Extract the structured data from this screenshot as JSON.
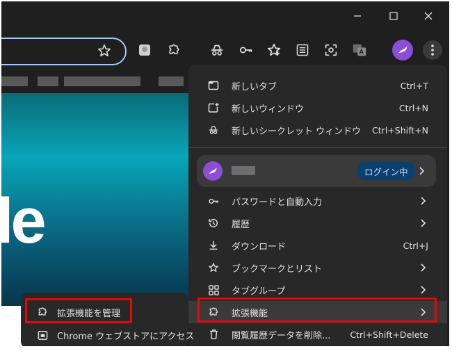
{
  "window_controls": {
    "minimize": "minimize",
    "maximize": "maximize",
    "close": "close"
  },
  "toolbar": {
    "icons": [
      "star-icon",
      "extension-app-icon",
      "puzzle-icon",
      "incognito-icon",
      "key-icon",
      "star-badge-icon",
      "reading-list-icon",
      "lens-icon",
      "translate-icon"
    ],
    "profile_icon": "bird-avatar",
    "menu_icon": "kebab-icon"
  },
  "menu": {
    "items_top": [
      {
        "label": "新しいタブ",
        "shortcut": "Ctrl+T",
        "icon": "new-tab-icon"
      },
      {
        "label": "新しいウィンドウ",
        "shortcut": "Ctrl+N",
        "icon": "new-window-icon"
      },
      {
        "label": "新しいシークレット ウィンドウ",
        "shortcut": "Ctrl+Shift+N",
        "icon": "incognito-icon"
      }
    ],
    "profile": {
      "status": "ログイン中"
    },
    "items_mid": [
      {
        "label": "パスワードと自動入力",
        "icon": "key-icon",
        "arrow": true
      },
      {
        "label": "履歴",
        "icon": "history-icon",
        "arrow": true
      },
      {
        "label": "ダウンロード",
        "shortcut": "Ctrl+J",
        "icon": "download-icon"
      },
      {
        "label": "ブックマークとリスト",
        "icon": "star-icon",
        "arrow": true
      },
      {
        "label": "タブグループ",
        "icon": "tab-groups-icon",
        "arrow": true
      },
      {
        "label": "拡張機能",
        "icon": "puzzle-icon",
        "arrow": true
      },
      {
        "label": "閲覧履歴データを削除...",
        "shortcut": "Ctrl+Shift+Delete",
        "icon": "trash-icon"
      }
    ]
  },
  "submenu": {
    "items": [
      {
        "label": "拡張機能を管理",
        "icon": "puzzle-icon"
      },
      {
        "label": "Chrome ウェブストアにアクセス",
        "icon": "web-store-icon"
      }
    ]
  },
  "page": {
    "partial_text": "le"
  },
  "colors": {
    "accent": "#a8c7fa",
    "highlight": "#e8060a",
    "menu_bg": "#282828",
    "avatar": "#8a4fd6",
    "badge_bg": "#0b3f6e",
    "badge_text": "#c2e2ff"
  }
}
